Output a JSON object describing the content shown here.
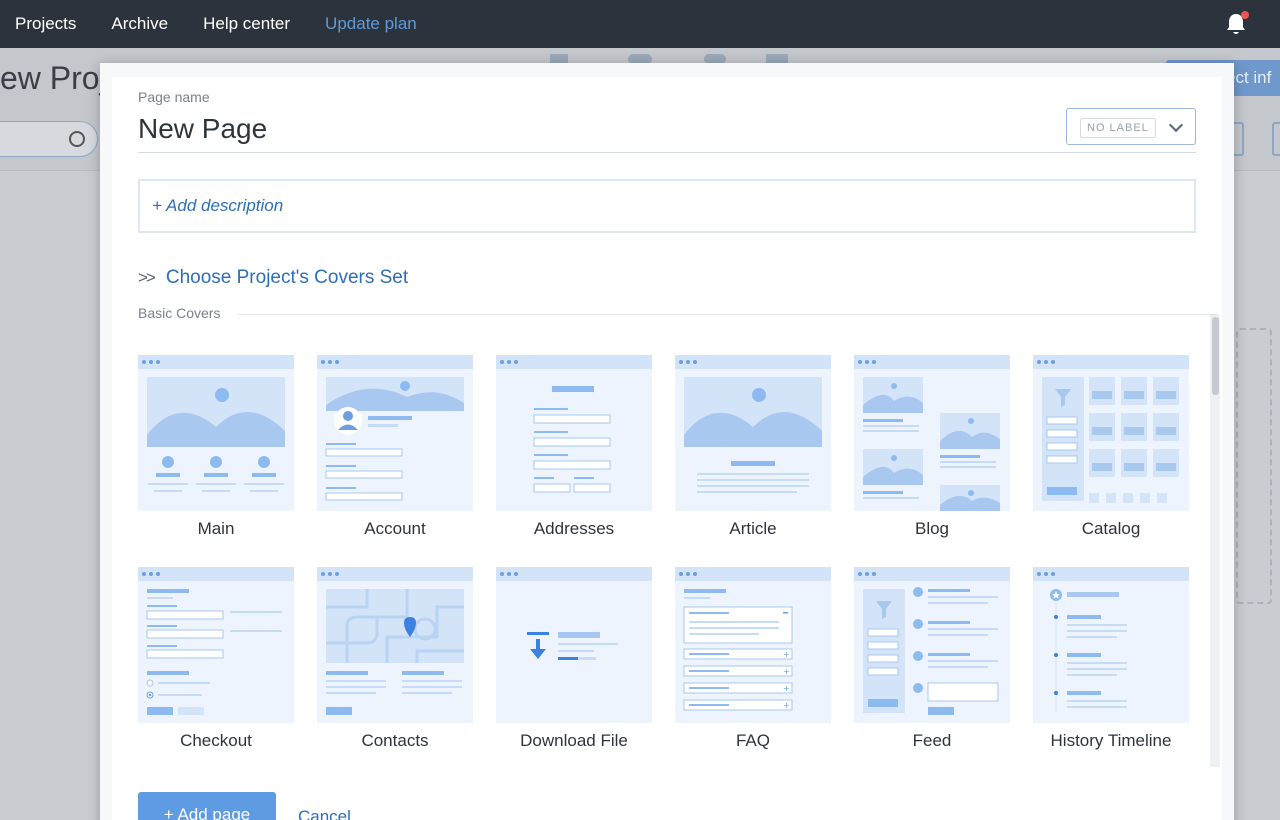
{
  "nav": {
    "links": [
      "Projects",
      "Archive",
      "Help center",
      "Update plan"
    ],
    "notification_color": "#ef5350"
  },
  "background": {
    "title": "ew Proj",
    "button_label": "ect inf"
  },
  "modal": {
    "page_name_label": "Page name",
    "page_name_value": "New Page",
    "label_select": "NO LABEL",
    "description_placeholder": "+ Add description",
    "covers_set_link": "Choose Project's Covers Set",
    "basic_covers_label": "Basic Covers",
    "covers": [
      {
        "name": "Main",
        "icon": "main-cover-icon"
      },
      {
        "name": "Account",
        "icon": "account-cover-icon"
      },
      {
        "name": "Addresses",
        "icon": "addresses-cover-icon"
      },
      {
        "name": "Article",
        "icon": "article-cover-icon"
      },
      {
        "name": "Blog",
        "icon": "blog-cover-icon"
      },
      {
        "name": "Catalog",
        "icon": "catalog-cover-icon"
      },
      {
        "name": "Checkout",
        "icon": "checkout-cover-icon"
      },
      {
        "name": "Contacts",
        "icon": "contacts-cover-icon"
      },
      {
        "name": "Download File",
        "icon": "download-file-cover-icon"
      },
      {
        "name": "FAQ",
        "icon": "faq-cover-icon"
      },
      {
        "name": "Feed",
        "icon": "feed-cover-icon"
      },
      {
        "name": "History Timeline",
        "icon": "history-timeline-cover-icon"
      }
    ],
    "add_page_button": "+ Add page",
    "cancel_link": "Cancel"
  },
  "colors": {
    "accent": "#2d6eb8",
    "button": "#5f9be3",
    "nav_bg": "#2d333d",
    "thumb_bg": "#edf4fd",
    "thumb_shape": "#b9d3f3"
  }
}
